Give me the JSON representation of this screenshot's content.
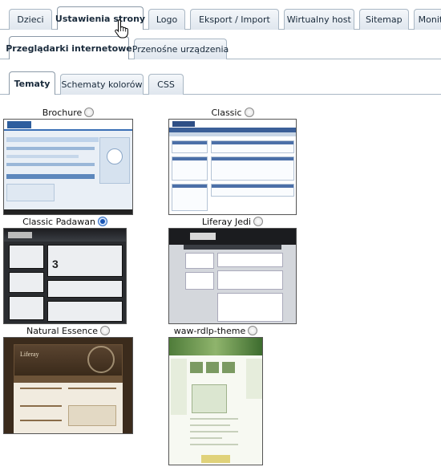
{
  "top_tabs": [
    "Dzieci",
    "Ustawienia strony",
    "Logo",
    "Eksport / Import",
    "Wirtualny host",
    "Sitemap",
    "Monitoro"
  ],
  "top_tabs_active": "Ustawienia strony",
  "device_tabs": [
    "Przeglądarki internetowe",
    "Przenośne urządzenia"
  ],
  "device_tabs_active": "Przeglądarki internetowe",
  "look_tabs": [
    "Tematy",
    "Schematy kolorów",
    "CSS"
  ],
  "look_tabs_active": "Tematy",
  "themes": [
    {
      "name": "Brochure",
      "selected": false
    },
    {
      "name": "Classic",
      "selected": false
    },
    {
      "name": "Classic Padawan",
      "selected": true
    },
    {
      "name": "Liferay Jedi",
      "selected": false
    },
    {
      "name": "Natural Essence",
      "selected": false
    },
    {
      "name": "waw-rdlp-theme",
      "selected": false
    }
  ],
  "thumbnail_texts": {
    "padawan_big": "3",
    "natural_title": "Liferay"
  },
  "colors": {
    "tab_border": "#a9b7c4",
    "radio_selected": "#1a56b5"
  }
}
